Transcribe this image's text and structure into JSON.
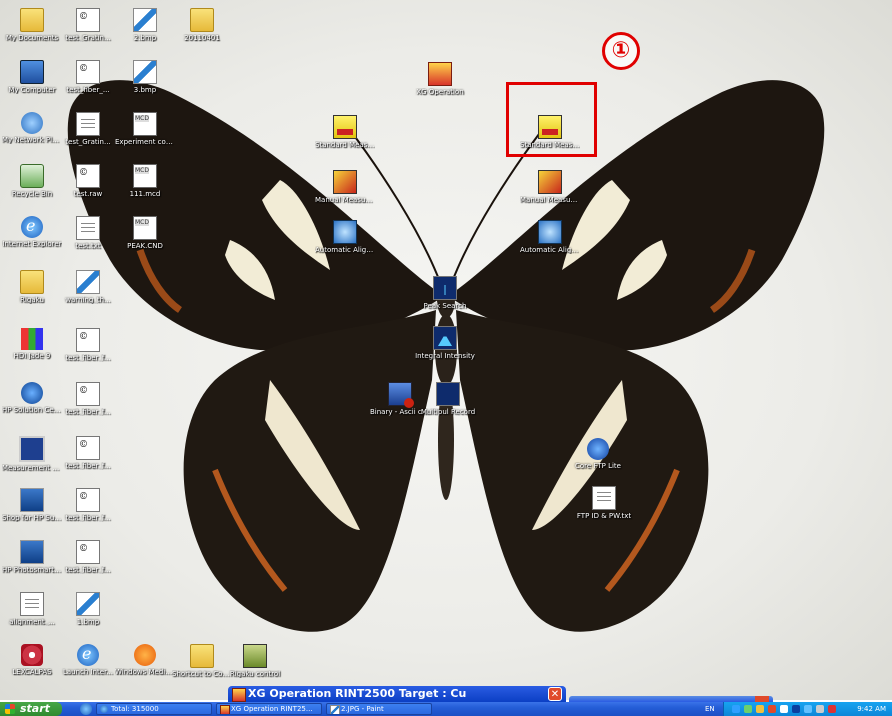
{
  "desktop": {
    "icons": [
      {
        "label": "My Documents",
        "glyph": "folder-icon",
        "cls": "g-folder"
      },
      {
        "label": "test_Gratin...",
        "glyph": "document-icon",
        "cls": "g-wrd"
      },
      {
        "label": "2.bmp",
        "glyph": "bitmap-icon",
        "cls": "g-paint"
      },
      {
        "label": "20110401",
        "glyph": "folder-icon",
        "cls": "g-folder"
      },
      {
        "label": "My Computer",
        "glyph": "computer-icon",
        "cls": "g-pc"
      },
      {
        "label": "test_fiber_...",
        "glyph": "document-icon",
        "cls": "g-wrd"
      },
      {
        "label": "3.bmp",
        "glyph": "bitmap-icon",
        "cls": "g-paint"
      },
      {
        "label": "My Network Places",
        "glyph": "network-icon",
        "cls": "g-net"
      },
      {
        "label": "test_Gratin...",
        "glyph": "notepad-icon",
        "cls": "g-doc"
      },
      {
        "label": "Experiment condition.mcd",
        "glyph": "mcd-file-icon",
        "cls": "g-mcd"
      },
      {
        "label": "Recycle Bin",
        "glyph": "recycle-bin-icon",
        "cls": "g-bin"
      },
      {
        "label": "test.raw",
        "glyph": "document-icon",
        "cls": "g-wrd"
      },
      {
        "label": "111.mcd",
        "glyph": "mcd-file-icon",
        "cls": "g-mcd"
      },
      {
        "label": "Internet Explorer",
        "glyph": "internet-explorer-icon",
        "cls": "g-ie"
      },
      {
        "label": "test.txt",
        "glyph": "notepad-icon",
        "cls": "g-doc"
      },
      {
        "label": "PEAK.CND",
        "glyph": "mcd-file-icon",
        "cls": "g-mcd"
      },
      {
        "label": "Rigaku",
        "glyph": "folder-icon",
        "cls": "g-folder"
      },
      {
        "label": "warning_th...",
        "glyph": "bitmap-icon",
        "cls": "g-paint"
      },
      {
        "label": "HDI Jade 9",
        "glyph": "jade-icon",
        "cls": "g-hdi"
      },
      {
        "label": "test_fiber_f...",
        "glyph": "document-icon",
        "cls": "g-wrd"
      },
      {
        "label": "HP Solution Center",
        "glyph": "hp-icon",
        "cls": "g-hp"
      },
      {
        "label": "test_fiber_f...",
        "glyph": "document-icon",
        "cls": "g-wrd"
      },
      {
        "label": "Measurement server",
        "glyph": "monitor-icon",
        "cls": "g-mon"
      },
      {
        "label": "test_fiber_f...",
        "glyph": "document-icon",
        "cls": "g-wrd"
      },
      {
        "label": "Shop for HP Supplies",
        "glyph": "shopping-icon",
        "cls": "g-shop"
      },
      {
        "label": "test_fiber_f...",
        "glyph": "document-icon",
        "cls": "g-wrd"
      },
      {
        "label": "HP Photosmart Essential 3.0",
        "glyph": "photosmart-icon",
        "cls": "g-shop"
      },
      {
        "label": "test_fiber_f...",
        "glyph": "document-icon",
        "cls": "g-wrd"
      },
      {
        "label": "alignment_...",
        "glyph": "notepad-icon",
        "cls": "g-doc"
      },
      {
        "label": "1.bmp",
        "glyph": "bitmap-icon",
        "cls": "g-paint"
      },
      {
        "label": "LEXCALPAS",
        "glyph": "disc-icon",
        "cls": "g-dvd"
      },
      {
        "label": "Launch Inter...",
        "glyph": "internet-explorer-icon",
        "cls": "g-ie"
      },
      {
        "label": "Windows Media Player",
        "glyph": "media-player-icon",
        "cls": "g-wmp"
      },
      {
        "label": "Shortcut to Control",
        "glyph": "folder-icon",
        "cls": "g-folder"
      },
      {
        "label": "Rigaku control",
        "glyph": "rigaku-icon",
        "cls": "g-rig"
      },
      {
        "label": "XG Operation",
        "glyph": "xg-operation-icon",
        "cls": "g-xg"
      },
      {
        "label": "Standard Measurem...",
        "glyph": "standard-measurement-icon",
        "cls": "g-meas"
      },
      {
        "label": "Standard Measurem...",
        "glyph": "standard-measurement-icon",
        "cls": "g-meas"
      },
      {
        "label": "Manual Measurem...",
        "glyph": "manual-measurement-icon",
        "cls": "g-man"
      },
      {
        "label": "Manual Measurem...",
        "glyph": "manual-measurement-icon",
        "cls": "g-man"
      },
      {
        "label": "Automatic Alignment ...",
        "glyph": "automatic-alignment-icon",
        "cls": "g-auto"
      },
      {
        "label": "Automatic Alignment (...",
        "glyph": "automatic-alignment-icon",
        "cls": "g-auto"
      },
      {
        "label": "Peak Search",
        "glyph": "peak-search-icon",
        "cls": "g-peak"
      },
      {
        "label": "Integral Intensity",
        "glyph": "integral-intensity-icon",
        "cls": "g-int"
      },
      {
        "label": "Binary - Ascii conversion",
        "glyph": "binary-ascii-icon",
        "cls": "g-bin2"
      },
      {
        "label": "Multipul Record",
        "glyph": "multiple-record-icon",
        "cls": "g-mult"
      },
      {
        "label": "Core FTP Lite",
        "glyph": "ftp-icon",
        "cls": "g-ftp"
      },
      {
        "label": "FTP ID & PW.txt",
        "glyph": "text-file-icon",
        "cls": "g-txt"
      }
    ],
    "annotation_number": "①",
    "annotation_color": "#e00000"
  },
  "windows": {
    "xg_title": "XG Operation RINT2500  Target : Cu",
    "close_glyph": "✕"
  },
  "taskbar": {
    "start_label": "start",
    "buttons": [
      {
        "label": "Total: 315000"
      },
      {
        "label": "XG Operation RINT25..."
      },
      {
        "label": "2.JPG - Paint"
      }
    ],
    "language": "EN",
    "clock": "9:42 AM"
  }
}
